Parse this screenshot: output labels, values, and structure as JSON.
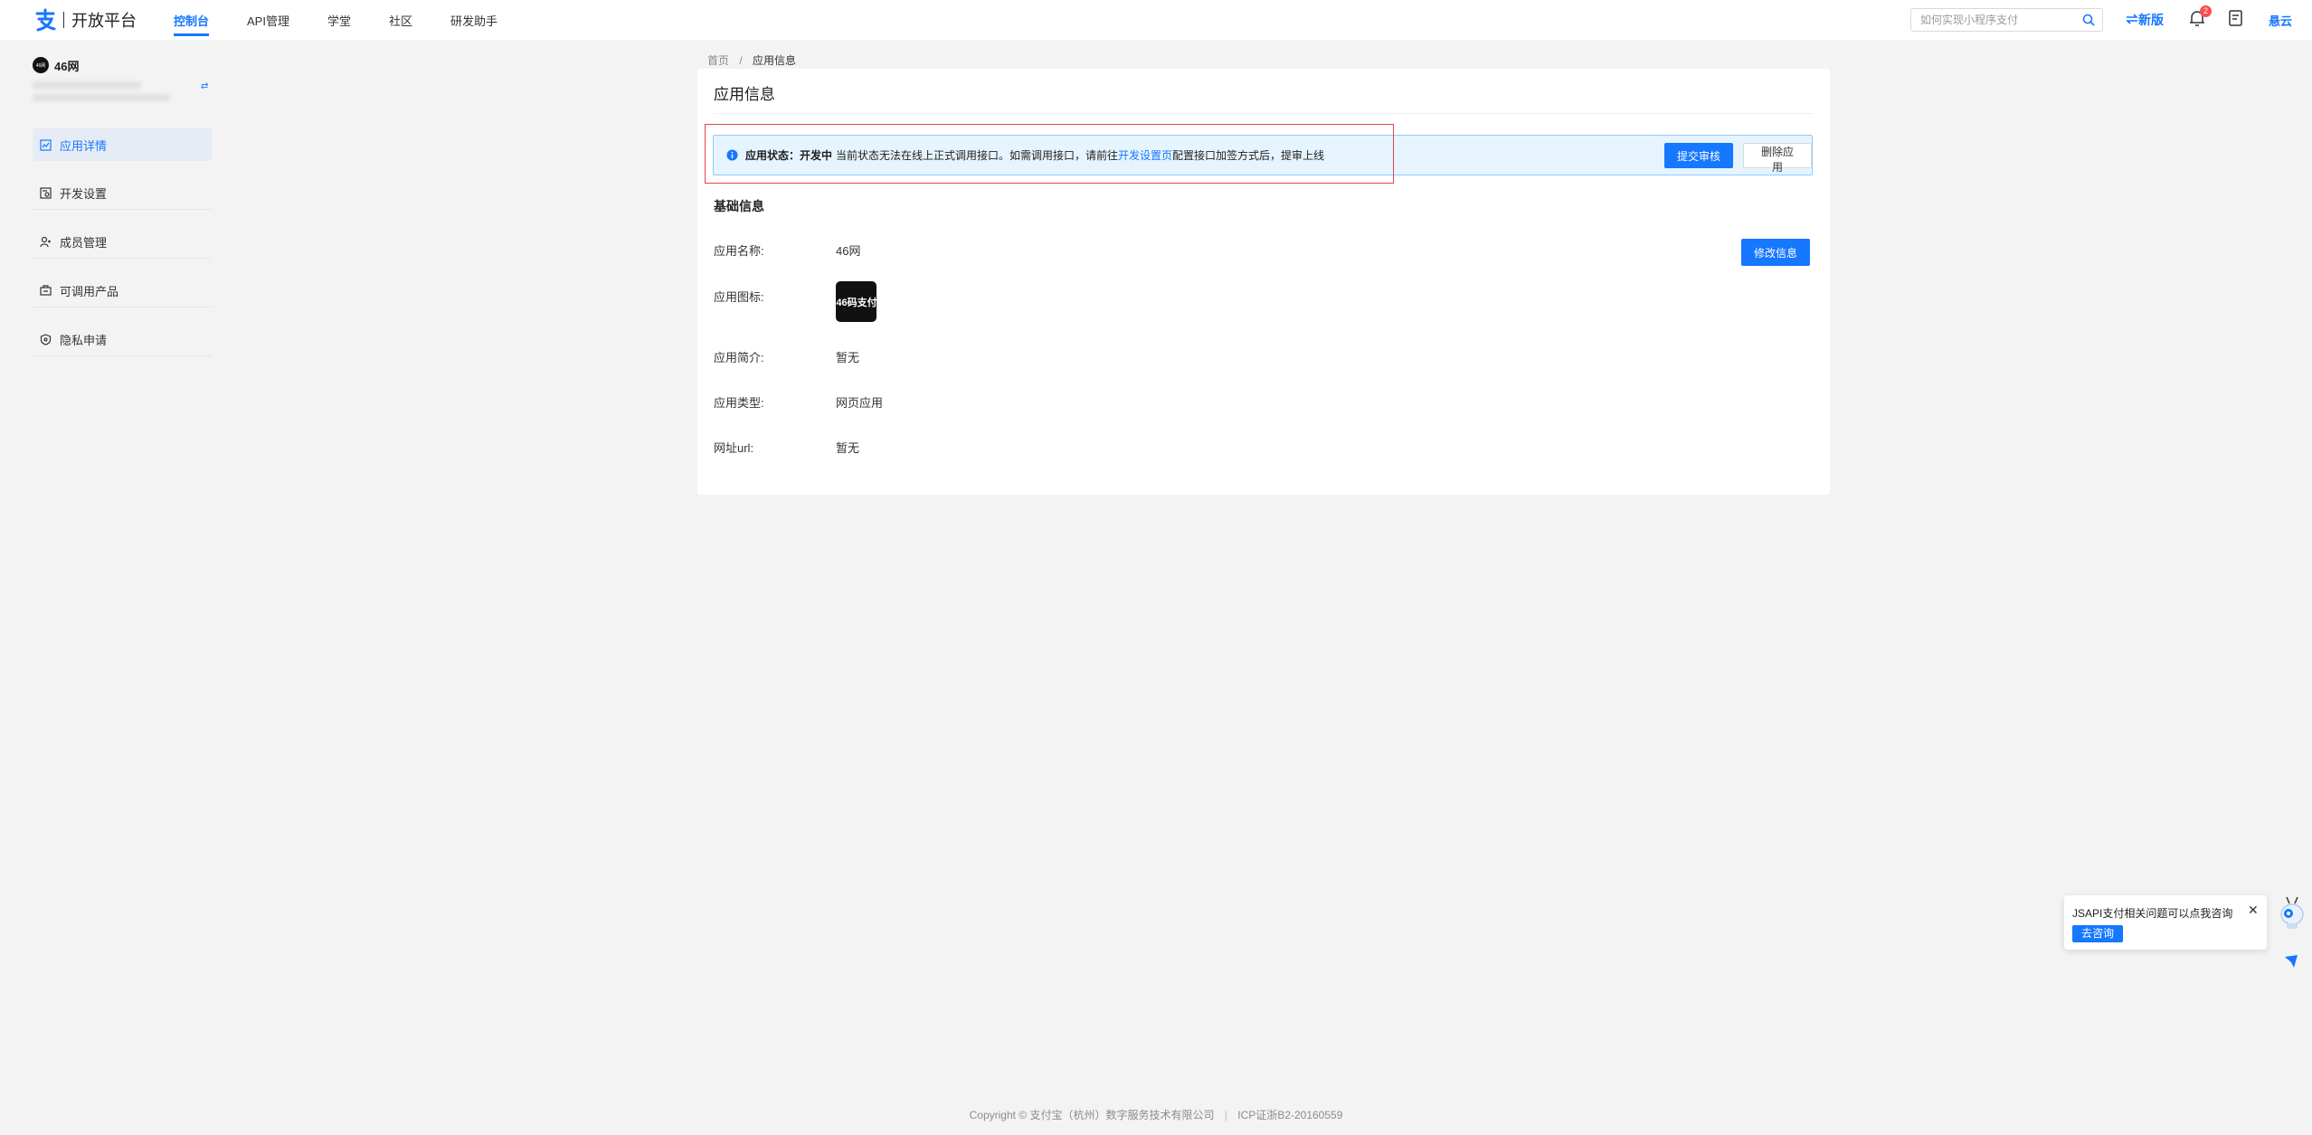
{
  "header": {
    "logo_text": "开放平台",
    "nav": [
      {
        "label": "控制台",
        "active": true
      },
      {
        "label": "API管理",
        "active": false
      },
      {
        "label": "学堂",
        "active": false
      },
      {
        "label": "社区",
        "active": false
      },
      {
        "label": "研发助手",
        "active": false
      }
    ],
    "search_placeholder": "如何实现小程序支付",
    "new_version_label": "新版",
    "notification_count": "2",
    "user_name": "悬云"
  },
  "sidebar": {
    "app_avatar_text": "46网",
    "app_name": "46网",
    "items": [
      {
        "label": "应用详情",
        "icon": "app-detail-icon",
        "active": true
      },
      {
        "label": "开发设置",
        "icon": "dev-settings-icon",
        "active": false
      },
      {
        "label": "成员管理",
        "icon": "members-icon",
        "active": false
      },
      {
        "label": "可调用产品",
        "icon": "products-icon",
        "active": false
      },
      {
        "label": "隐私申请",
        "icon": "privacy-shield-icon",
        "active": false
      }
    ]
  },
  "breadcrumb": {
    "home": "首页",
    "separator": "/",
    "current": "应用信息"
  },
  "main": {
    "title": "应用信息",
    "status": {
      "label": "应用状态：开发中",
      "message_before_link": "当前状态无法在线上正式调用接口。如需调用接口，请前往",
      "link": "开发设置页",
      "message_after_link": "配置接口加签方式后，提审上线",
      "submit_button": "提交审核",
      "delete_button": "删除应用"
    },
    "section_title": "基础信息",
    "edit_button": "修改信息",
    "fields": {
      "name_label": "应用名称:",
      "name_value": "46网",
      "icon_label": "应用图标:",
      "icon_text": "46码支付",
      "intro_label": "应用简介:",
      "intro_value": "暂无",
      "type_label": "应用类型:",
      "type_value": "网页应用",
      "url_label": "网址url:",
      "url_value": "暂无"
    }
  },
  "footer": {
    "copyright": "Copyright © 支付宝（杭州）数字服务技术有限公司",
    "separator": "|",
    "icp": "ICP证浙B2-20160559"
  },
  "assistant": {
    "text": "JSAPI支付相关问题可以点我咨询",
    "consult_button": "去咨询"
  },
  "colors": {
    "accent": "#1677ff",
    "status_bg": "#e6f4ff",
    "highlight": "#e0454b",
    "page_bg": "#f3f3f3"
  }
}
